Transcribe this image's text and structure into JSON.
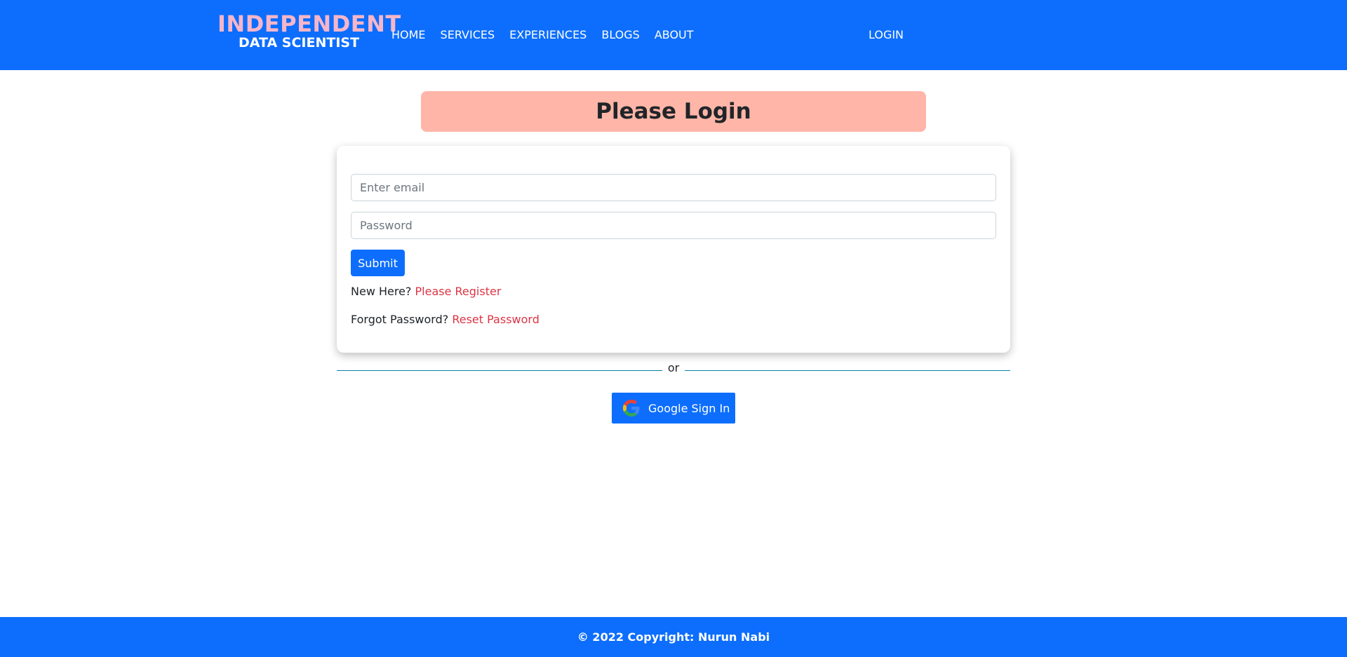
{
  "brand": {
    "line1": "INDEPENDENT",
    "line2": "DATA SCIENTIST"
  },
  "nav": {
    "items": [
      "HOME",
      "SERVICES",
      "EXPERIENCES",
      "BLOGS",
      "ABOUT"
    ],
    "login": "LOGIN"
  },
  "page": {
    "title": "Please Login"
  },
  "form": {
    "email_placeholder": "Enter email",
    "password_placeholder": "Password",
    "submit_label": "Submit",
    "register_prompt": "New Here?",
    "register_link": "Please Register",
    "reset_prompt": "Forgot Password?",
    "reset_link": "Reset Password"
  },
  "divider": {
    "text": "or"
  },
  "google": {
    "label": "Google Sign In",
    "icon": "google-icon"
  },
  "footer": {
    "text": "© 2022 Copyright: Nurun Nabi"
  },
  "colors": {
    "primary": "#0d6efd",
    "banner": "#ffb6a8",
    "brand_pink": "#f7b6c8",
    "link_red": "#dc3545"
  }
}
